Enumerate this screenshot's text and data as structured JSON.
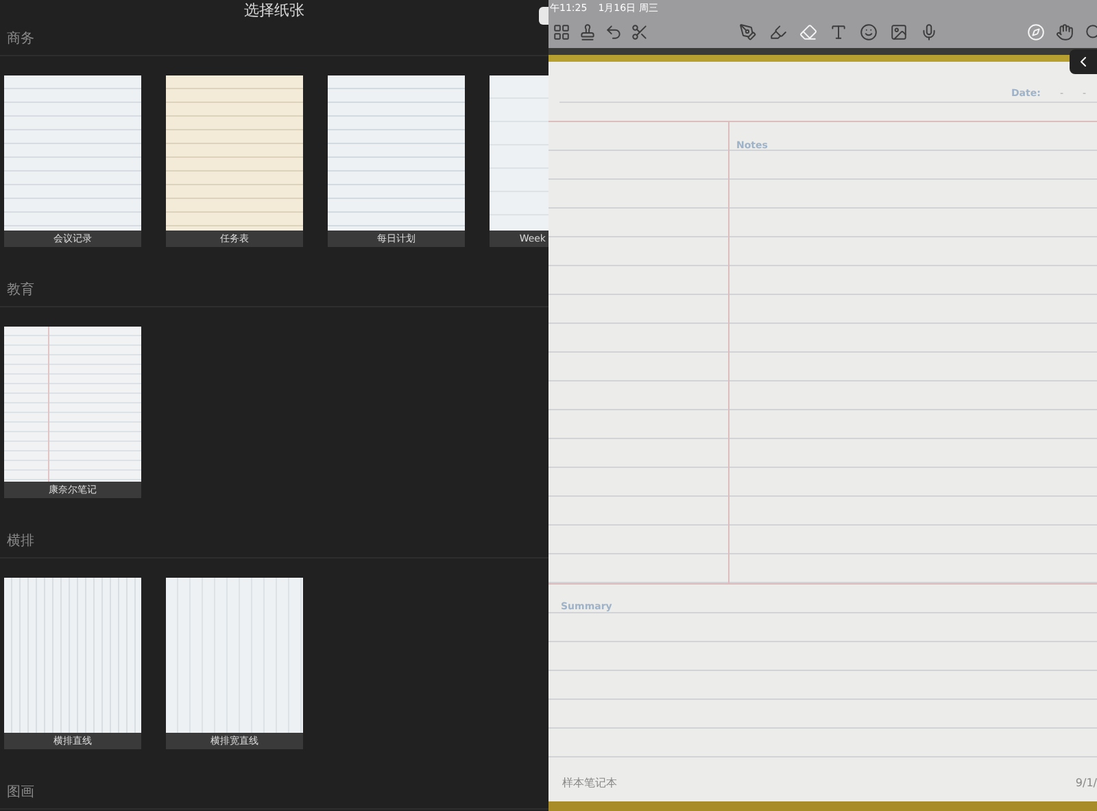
{
  "picker": {
    "title": "选择纸张",
    "sections": [
      {
        "title": "商务",
        "templates": [
          {
            "label": "会议记录",
            "kind": "meeting"
          },
          {
            "label": "任务表",
            "kind": "tasks"
          },
          {
            "label": "每日计划",
            "kind": "planner"
          },
          {
            "label": "Week",
            "kind": "weekly"
          }
        ]
      },
      {
        "title": "教育",
        "templates": [
          {
            "label": "康奈尔笔记",
            "kind": "cornell"
          }
        ]
      },
      {
        "title": "横排",
        "templates": [
          {
            "label": "横排直线",
            "kind": "lines"
          },
          {
            "label": "横排宽直线",
            "kind": "wide-lines"
          }
        ]
      },
      {
        "title": "图画"
      }
    ]
  },
  "status_bar": {
    "time": "午11:25",
    "date": "1月16日 周三"
  },
  "notebook": {
    "date_label": "Date:",
    "date_marks": [
      "-",
      "-"
    ],
    "notes_label": "Notes",
    "summary_label": "Summary",
    "footer": "样本笔记本",
    "footer_date": "9/1/"
  }
}
